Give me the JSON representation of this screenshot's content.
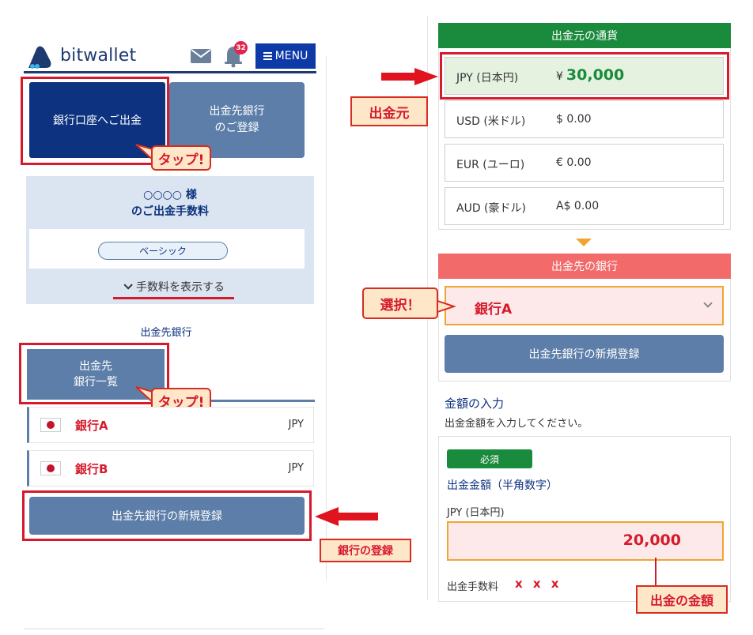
{
  "header": {
    "logo_text": "bitwallet",
    "notification_count": "32",
    "menu_label": "MENU"
  },
  "tabs": {
    "withdraw_label": "銀行口座へご出金",
    "register_label_1": "出金先銀行",
    "register_label_2": "のご登録"
  },
  "callouts": {
    "tap": "タップ!",
    "source": "出金元",
    "select": "選択！",
    "bank_registration": "銀行の登録",
    "amount": "出金の金額"
  },
  "fee_card": {
    "user_line": "○○○○ 様",
    "fee_line": "のご出金手数料",
    "plan": "ベーシック",
    "show_fee": "手数料を表示する"
  },
  "destination": {
    "section_label": "出金先銀行",
    "list_button_1": "出金先",
    "list_button_2": "銀行一覧",
    "banks": [
      {
        "name": "銀行A",
        "currency": "JPY"
      },
      {
        "name": "銀行B",
        "currency": "JPY"
      }
    ],
    "register_button": "出金先銀行の新規登録"
  },
  "source_currency": {
    "header": "出金元の通貨",
    "rows": [
      {
        "name": "JPY (日本円)",
        "symbol": "¥",
        "value": "30,000"
      },
      {
        "name": "USD (米ドル)",
        "value": "$ 0.00"
      },
      {
        "name": "EUR (ユーロ)",
        "value": "€ 0.00"
      },
      {
        "name": "AUD (豪ドル)",
        "value": "A$ 0.00"
      }
    ]
  },
  "dest_bank": {
    "header": "出金先の銀行",
    "selected": "銀行A",
    "register_button": "出金先銀行の新規登録"
  },
  "amount": {
    "title": "金額の入力",
    "subtitle": "出金金額を入力してください。",
    "required": "必須",
    "field_label": "出金金額（半角数字）",
    "currency_label": "JPY (日本円)",
    "value": "20,000",
    "fee_label": "出金手数料",
    "fee_value": "x x x"
  },
  "colors": {
    "navy": "#0d3280",
    "steel_blue": "#5c7ea8",
    "green": "#1a8a3c",
    "salmon": "#f26a6a",
    "highlight_red": "#d61a2c",
    "orange": "#f0a533"
  }
}
